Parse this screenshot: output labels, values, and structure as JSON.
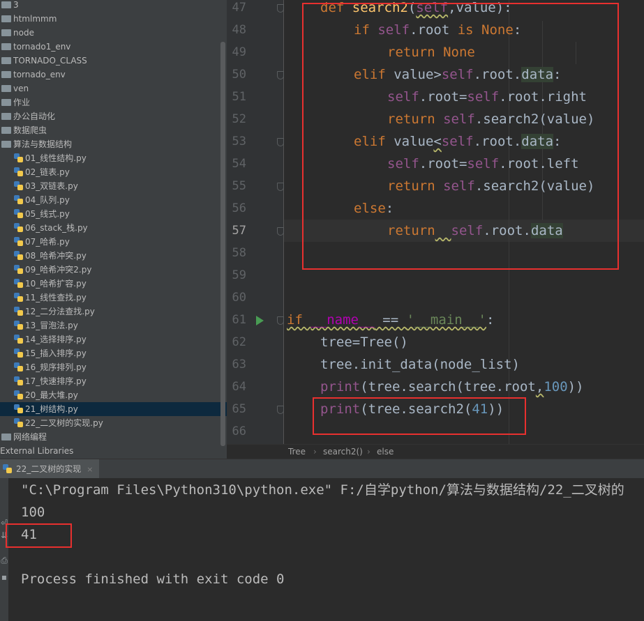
{
  "project_tree": {
    "items": [
      {
        "label": "3",
        "type": "folder",
        "indent": 0
      },
      {
        "label": "htmlmmm",
        "type": "folder",
        "indent": 0
      },
      {
        "label": "node",
        "type": "folder",
        "indent": 0
      },
      {
        "label": "tornado1_env",
        "type": "folder",
        "indent": 0
      },
      {
        "label": "TORNADO_CLASS",
        "type": "folder",
        "indent": 0
      },
      {
        "label": "tornado_env",
        "type": "folder",
        "indent": 0
      },
      {
        "label": "ven",
        "type": "folder",
        "indent": 0
      },
      {
        "label": "作业",
        "type": "folder",
        "indent": 0
      },
      {
        "label": "办公自动化",
        "type": "folder",
        "indent": 0
      },
      {
        "label": "数据爬虫",
        "type": "folder",
        "indent": 0
      },
      {
        "label": "算法与数据结构",
        "type": "folder",
        "indent": 0
      },
      {
        "label": "01_线性结构.py",
        "type": "py",
        "indent": 1
      },
      {
        "label": "02_链表.py",
        "type": "py",
        "indent": 1
      },
      {
        "label": "03_双链表.py",
        "type": "py",
        "indent": 1
      },
      {
        "label": "04_队列.py",
        "type": "py",
        "indent": 1
      },
      {
        "label": "05_线式.py",
        "type": "py",
        "indent": 1
      },
      {
        "label": "06_stack_栈.py",
        "type": "py",
        "indent": 1
      },
      {
        "label": "07_哈希.py",
        "type": "py",
        "indent": 1
      },
      {
        "label": "08_哈希冲突.py",
        "type": "py",
        "indent": 1
      },
      {
        "label": "09_哈希冲突2.py",
        "type": "py",
        "indent": 1
      },
      {
        "label": "10_哈希扩容.py",
        "type": "py",
        "indent": 1
      },
      {
        "label": "11_线性查找.py",
        "type": "py",
        "indent": 1
      },
      {
        "label": "12_二分法查找.py",
        "type": "py",
        "indent": 1
      },
      {
        "label": "13_冒泡法.py",
        "type": "py",
        "indent": 1
      },
      {
        "label": "14_选择排序.py",
        "type": "py",
        "indent": 1
      },
      {
        "label": "15_插入排序.py",
        "type": "py",
        "indent": 1
      },
      {
        "label": "16_规序排列.py",
        "type": "py",
        "indent": 1
      },
      {
        "label": "17_快速排序.py",
        "type": "py",
        "indent": 1
      },
      {
        "label": "20_最大堆.py",
        "type": "py",
        "indent": 1
      },
      {
        "label": "21_树结构.py",
        "type": "py",
        "indent": 1,
        "selected": true
      },
      {
        "label": "22_二叉树的实现.py",
        "type": "py",
        "indent": 1
      },
      {
        "label": "网络编程",
        "type": "folder",
        "indent": 0
      },
      {
        "label": "External Libraries",
        "type": "lib",
        "indent": 0
      }
    ]
  },
  "editor": {
    "current_line": "57",
    "line_numbers": [
      "47",
      "48",
      "49",
      "50",
      "51",
      "52",
      "53",
      "54",
      "55",
      "56",
      "57",
      "58",
      "59",
      "60",
      "61",
      "62",
      "63",
      "64",
      "65",
      "66"
    ]
  },
  "breadcrumb": {
    "items": [
      "Tree",
      "search2()",
      "else"
    ],
    "separator": "›"
  },
  "run_panel": {
    "tab_label": "22_二叉树的实现",
    "close_glyph": "×",
    "output": [
      "\"C:\\Program Files\\Python310\\python.exe\" F:/自学python/算法与数据结构/22_二叉树的",
      "100",
      "41",
      "",
      "Process finished with exit code 0"
    ]
  },
  "colors": {
    "keyword": "#cc7832",
    "self": "#94558d",
    "function": "#ffc66d",
    "string": "#6a8759",
    "number": "#6897bb",
    "annotation_box": "#e8302f"
  }
}
